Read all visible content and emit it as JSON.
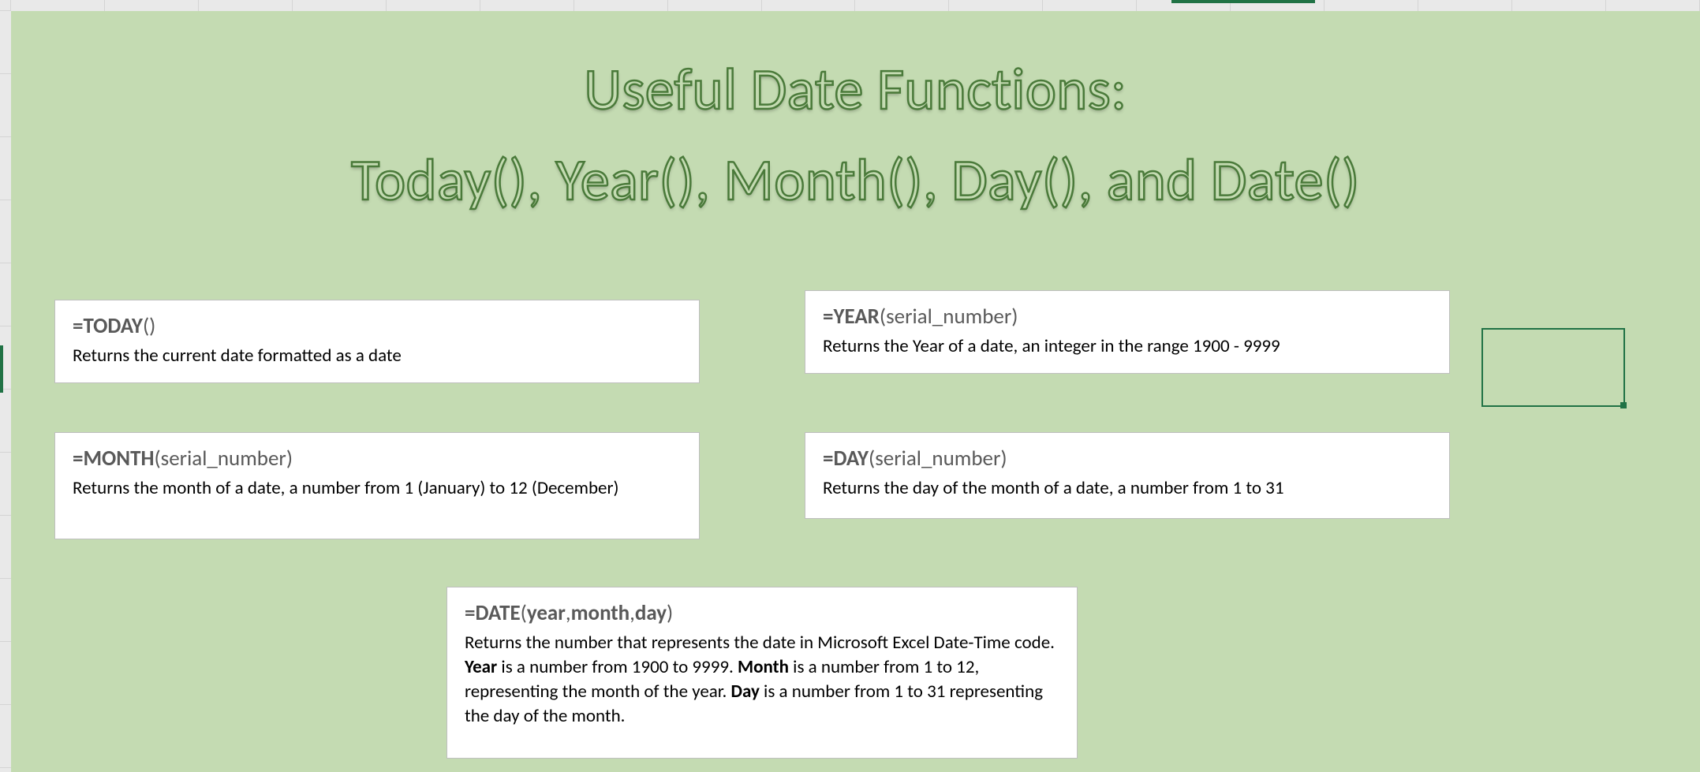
{
  "title_line1": "Useful Date Functions:",
  "title_line2": "Today(), Year(), Month(), Day(), and Date()",
  "cards": {
    "today": {
      "prefix": "=",
      "name": "TODAY",
      "args": "()",
      "desc": "Returns the current date formatted as a date"
    },
    "year": {
      "prefix": "=",
      "name": "YEAR",
      "args": "(serial_number)",
      "desc": "Returns the Year of a date, an integer in the range 1900 - 9999"
    },
    "month": {
      "prefix": "=",
      "name": "MONTH",
      "args": "(serial_number)",
      "desc": "Returns the month of a date, a number from 1 (January) to 12 (December)"
    },
    "day": {
      "prefix": "=",
      "name": "DAY",
      "args": "(serial_number)",
      "desc": "Returns the day of the month of a date, a number from 1 to 31"
    },
    "date": {
      "prefix": "=",
      "name": "DATE",
      "open": "(",
      "arg1": "year",
      "sep1": ",",
      "arg2": "month",
      "sep2": ",",
      "arg3": "day",
      "close": ")",
      "desc_parts": {
        "t1": "Returns the number that represents the date in Microsoft Excel Date-Time code. ",
        "b1": "Year",
        "t2": " is a number from 1900 to 9999. ",
        "b2": "Month",
        "t3": " is a number from 1 to 12, representing the month of the year. ",
        "b3": "Day",
        "t4": " is a number from 1 to 31 representing the day of the month."
      }
    }
  }
}
